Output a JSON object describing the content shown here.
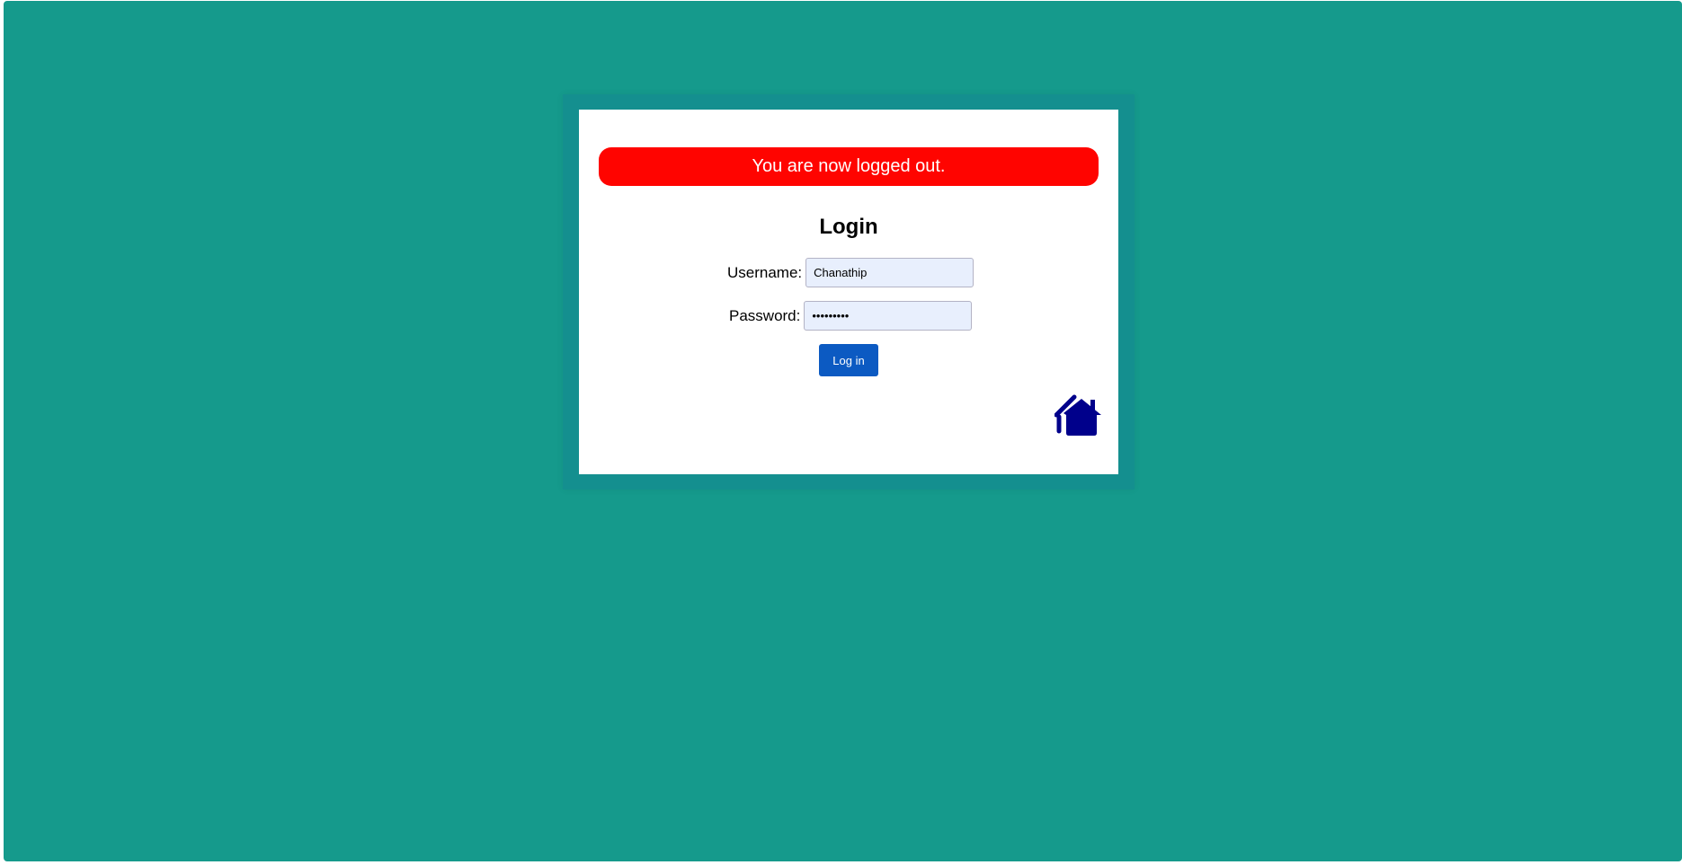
{
  "alert": {
    "message": "You are now logged out."
  },
  "login": {
    "title": "Login",
    "username_label": "Username:",
    "username_value": "Chanathip",
    "password_label": "Password:",
    "password_value": "•••••••••",
    "submit_label": "Log in"
  },
  "icons": {
    "home": "home-icon"
  },
  "colors": {
    "background": "#159a8c",
    "frame": "#148f8f",
    "alert": "#ff0400",
    "button": "#0c5ac2",
    "home_icon": "#00008b"
  }
}
